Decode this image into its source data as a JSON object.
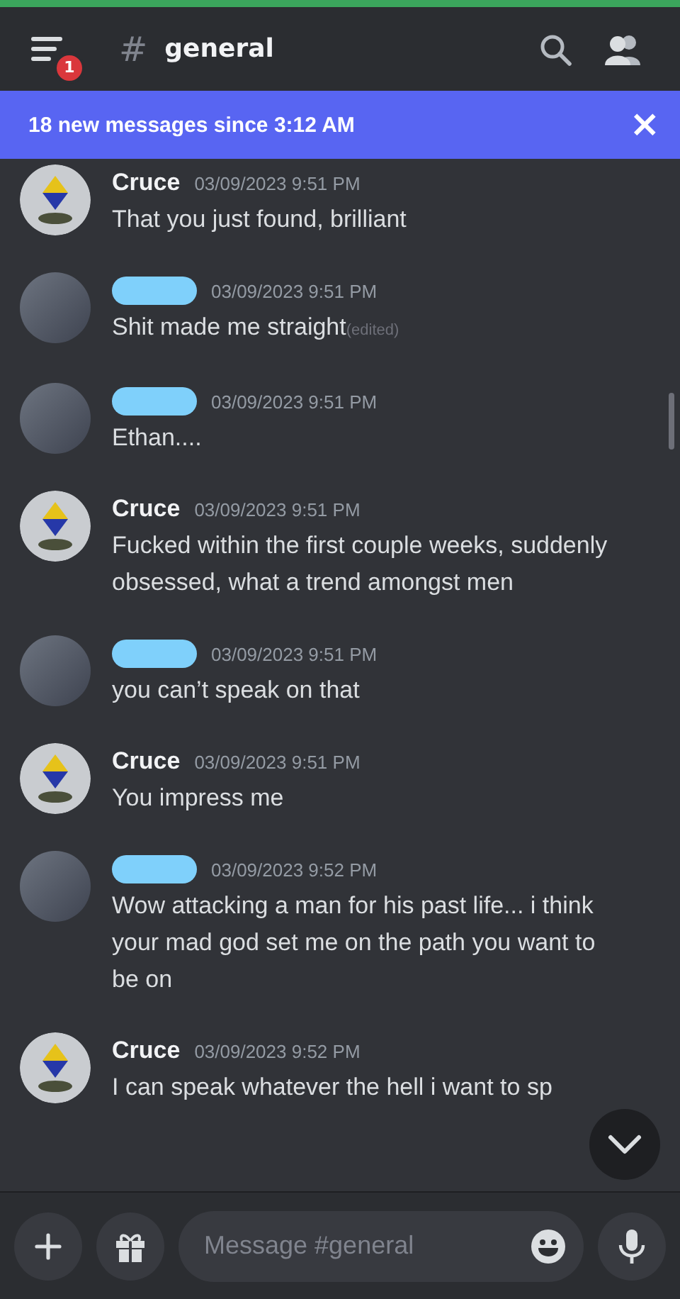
{
  "header": {
    "unread_badge": "1",
    "hash": "#",
    "channel": "general"
  },
  "banner": {
    "text": "18 new messages since 3:12 AM",
    "close": "×"
  },
  "messages": [
    {
      "kind": "named",
      "author": "Cruce",
      "time": "03/09/2023 9:51 PM",
      "text": "That you just found, brilliant"
    },
    {
      "kind": "redacted",
      "time": "03/09/2023 9:51 PM",
      "text": "Shit made me straight",
      "edited": "(edited)"
    },
    {
      "kind": "redacted",
      "time": "03/09/2023 9:51 PM",
      "text": "Ethan...."
    },
    {
      "kind": "named",
      "author": "Cruce",
      "time": "03/09/2023 9:51 PM",
      "text": "Fucked within the first couple weeks, suddenly obsessed, what a trend amongst men"
    },
    {
      "kind": "redacted",
      "time": "03/09/2023 9:51 PM",
      "text": "you can’t speak on that"
    },
    {
      "kind": "named",
      "author": "Cruce",
      "time": "03/09/2023 9:51 PM",
      "text": "You impress me"
    },
    {
      "kind": "redacted",
      "time": "03/09/2023 9:52 PM",
      "text": "Wow attacking a man for his past life... i think your mad god set me on the path you want to be on"
    },
    {
      "kind": "named",
      "author": "Cruce",
      "time": "03/09/2023 9:52 PM",
      "text": "I can speak whatever the hell i want to sp"
    }
  ],
  "composer": {
    "placeholder": "Message #general"
  }
}
